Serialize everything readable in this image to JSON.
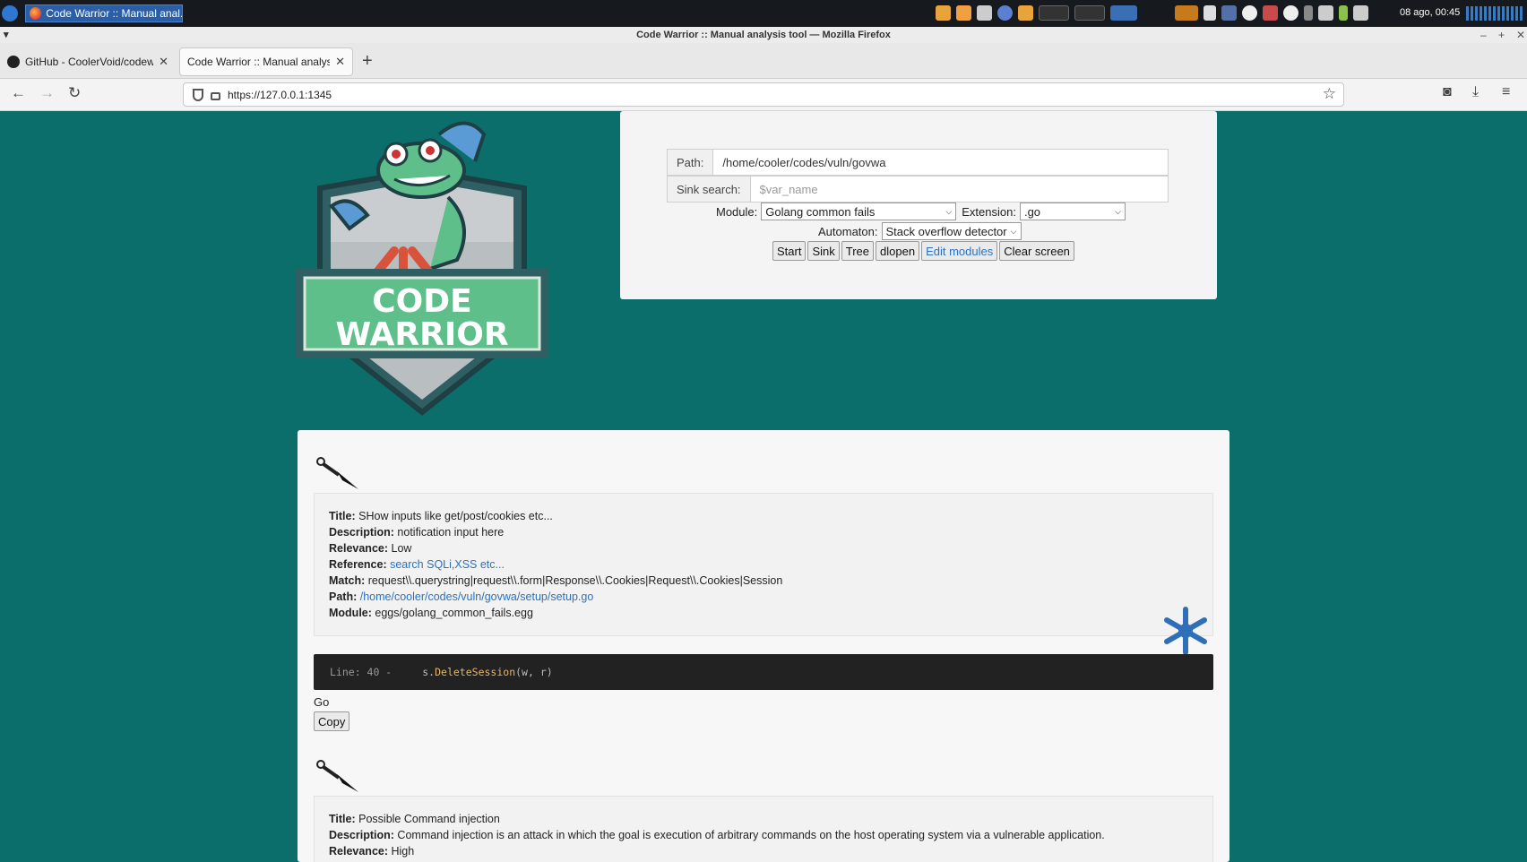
{
  "taskbar": {
    "active_task": "Code Warrior :: Manual anal...",
    "clock": "08 ago, 00:45"
  },
  "window": {
    "title": "Code Warrior :: Manual analysis tool — Mozilla Firefox"
  },
  "tabs": [
    {
      "label": "GitHub - CoolerVoid/codewarrior"
    },
    {
      "label": "Code Warrior :: Manual analysis tool"
    }
  ],
  "nav": {
    "url": "https://127.0.0.1:1345"
  },
  "logo": {
    "line1": "CODE",
    "line2": "WARRIOR"
  },
  "form": {
    "path_label": "Path:",
    "path_value": "/home/cooler/codes/vuln/govwa",
    "sink_label": "Sink search:",
    "sink_placeholder": "$var_name",
    "module_label": "Module:",
    "module_value": "Golang common fails",
    "extension_label": "Extension:",
    "extension_value": ".go",
    "automaton_label": "Automaton:",
    "automaton_value": "Stack overflow detector",
    "buttons": [
      "Start",
      "Sink",
      "Tree",
      "dlopen",
      "Edit modules",
      "Clear screen"
    ]
  },
  "result1": {
    "title_label": "Title:",
    "title": "SHow inputs like get/post/cookies etc...",
    "description_label": "Description:",
    "description": "notification input here",
    "relevance_label": "Relevance:",
    "relevance": "Low",
    "reference_label": "Reference:",
    "reference": "search SQLi,XSS etc...",
    "match_label": "Match:",
    "match": "request\\\\.querystring|request\\\\.form|Response\\\\.Cookies|Request\\\\.Cookies|Session",
    "path_label": "Path:",
    "path": "/home/cooler/codes/vuln/govwa/setup/setup.go",
    "module_label": "Module:",
    "module": "eggs/golang_common_fails.egg",
    "code_line": "Line: 40 -",
    "code_obj": "s.",
    "code_fn": "DeleteSession",
    "code_args": "(w, r)",
    "lang": "Go",
    "copy": "Copy"
  },
  "result2": {
    "title_label": "Title:",
    "title": "Possible Command injection",
    "description_label": "Description:",
    "description": "Command injection is an attack in which the goal is execution of arbitrary commands on the host operating system via a vulnerable application.",
    "relevance_label": "Relevance:",
    "relevance": "High"
  },
  "colors": {
    "page_bg": "#0b6e6b",
    "link": "#2a72c0",
    "code_bg": "#222222",
    "logo_green": "#5fbf8a"
  }
}
